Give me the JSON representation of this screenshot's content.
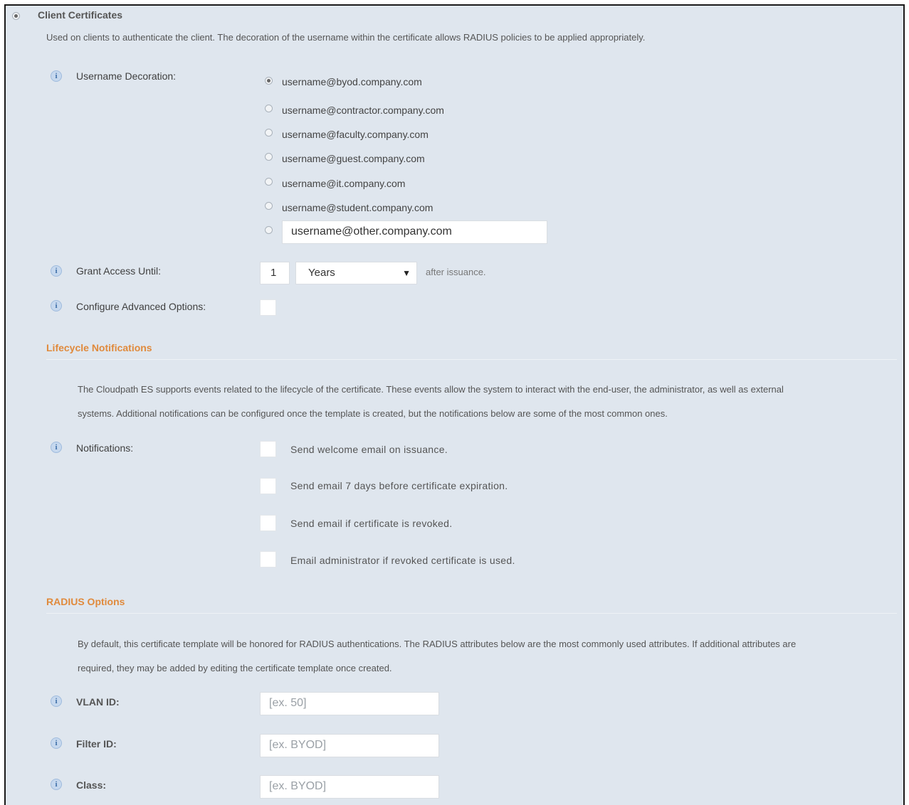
{
  "client_certificates": {
    "title": "Client Certificates",
    "description": "Used on clients to authenticate the client. The decoration of the username within the certificate allows RADIUS policies to be applied appropriately.",
    "username_decoration": {
      "label": "Username Decoration:",
      "options": [
        {
          "label": "username@byod.company.com",
          "selected": true
        },
        {
          "label": "username@contractor.company.com",
          "selected": false
        },
        {
          "label": "username@faculty.company.com",
          "selected": false
        },
        {
          "label": "username@guest.company.com",
          "selected": false
        },
        {
          "label": "username@it.company.com",
          "selected": false
        },
        {
          "label": "username@student.company.com",
          "selected": false
        }
      ],
      "other_value": "username@other.company.com"
    },
    "grant_access": {
      "label": "Grant Access Until:",
      "value": "1",
      "unit": "Years",
      "suffix": "after issuance."
    },
    "advanced": {
      "label": "Configure Advanced Options:",
      "checked": false
    }
  },
  "lifecycle": {
    "title": "Lifecycle Notifications",
    "description_line1": "The Cloudpath ES supports events related to the lifecycle of the certificate. These events allow the system to interact with the end-user, the administrator, as well as external",
    "description_line2": "systems. Additional notifications can be configured once the template is created, but the notifications below are some of the most common ones.",
    "notifications_label": "Notifications:",
    "notifications": [
      {
        "label": "Send welcome email on issuance.",
        "checked": false
      },
      {
        "label": "Send email 7 days before certificate expiration.",
        "checked": false
      },
      {
        "label": "Send email if certificate is revoked.",
        "checked": false
      },
      {
        "label": "Email administrator if revoked certificate is used.",
        "checked": false
      }
    ]
  },
  "radius": {
    "title": "RADIUS Options",
    "description_line1": "By default, this certificate template will be honored for RADIUS authentications. The RADIUS attributes below are the most commonly used attributes. If additional attributes are",
    "description_line2": "required, they may be added by editing the certificate template once created.",
    "vlan_label": "VLAN ID:",
    "vlan_placeholder": "[ex. 50]",
    "filter_label": "Filter ID:",
    "filter_placeholder": "[ex. BYOD]",
    "class_label": "Class:",
    "class_placeholder": "[ex. BYOD]"
  },
  "icons": {
    "info": "i",
    "dropdown_arrow": "▼"
  },
  "colors": {
    "background": "#dfe6ee",
    "section_heading": "#e08a3c",
    "info_icon": "#3f6fa8"
  }
}
